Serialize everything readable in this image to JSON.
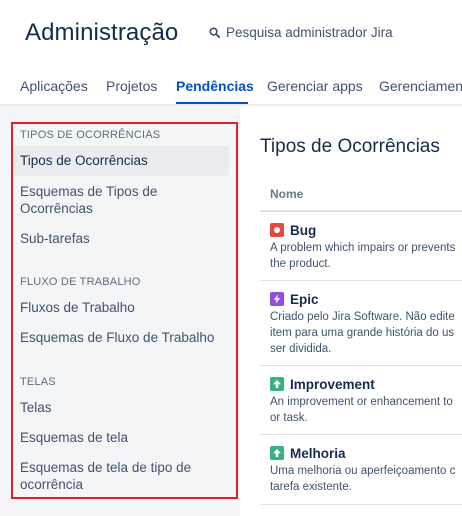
{
  "header": {
    "title": "Administração",
    "search_label": "Pesquisa administrador Jira",
    "tabs": [
      {
        "label": "Aplicações"
      },
      {
        "label": "Projetos"
      },
      {
        "label": "Pendências"
      },
      {
        "label": "Gerenciar apps"
      },
      {
        "label": "Gerenciamento"
      }
    ],
    "active_tab": "Pendências"
  },
  "sidebar": {
    "sections": [
      {
        "title": "TIPOS DE OCORRÊNCIAS",
        "items": [
          {
            "label": "Tipos de Ocorrências"
          },
          {
            "label_line1": "Esquemas de Tipos de",
            "label_line2": "Ocorrências"
          },
          {
            "label": "Sub-tarefas"
          }
        ]
      },
      {
        "title": "FLUXO DE TRABALHO",
        "items": [
          {
            "label": "Fluxos de Trabalho"
          },
          {
            "label": "Esquemas de Fluxo de Trabalho"
          }
        ]
      },
      {
        "title": "TELAS",
        "items": [
          {
            "label": "Telas"
          },
          {
            "label": "Esquemas de tela"
          },
          {
            "label_line1": "Esquemas de tela de tipo de",
            "label_line2": "ocorrência"
          }
        ]
      }
    ],
    "selected_item": "Tipos de Ocorrências"
  },
  "main": {
    "title": "Tipos de Ocorrências",
    "column_header": "Nome",
    "issue_types": [
      {
        "name": "Bug",
        "icon": "bug-icon",
        "color": "#e5493a",
        "desc_line1": "A problem which impairs or prevents",
        "desc_line2": "the product."
      },
      {
        "name": "Epic",
        "icon": "epic-icon",
        "color": "#904ee2",
        "desc_line1": "Criado pelo Jira Software. Não edite",
        "desc_line2": "item para uma grande história do us",
        "desc_line3": "ser dividida."
      },
      {
        "name": "Improvement",
        "icon": "improvement-icon",
        "color": "#36b37e",
        "desc_line1": "An improvement or enhancement to",
        "desc_line2": "or task."
      },
      {
        "name": "Melhoria",
        "icon": "melhoria-icon",
        "color": "#36b37e",
        "desc_line1": "Uma melhoria ou aperfeiçoamento c",
        "desc_line2": "tarefa existente."
      }
    ]
  },
  "colors": {
    "accent": "#0052cc",
    "highlight_outline": "#e0202a",
    "sidebar_bg": "#f4f5f7"
  }
}
